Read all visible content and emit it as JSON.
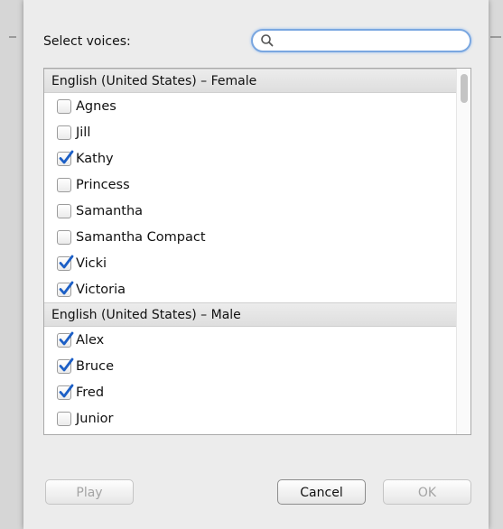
{
  "dialog": {
    "select_label": "Select voices:",
    "search": {
      "value": "",
      "placeholder": ""
    }
  },
  "voice_groups": [
    {
      "header": "English (United States) – Female",
      "voices": [
        {
          "name": "Agnes",
          "checked": false
        },
        {
          "name": "Jill",
          "checked": false
        },
        {
          "name": "Kathy",
          "checked": true
        },
        {
          "name": "Princess",
          "checked": false
        },
        {
          "name": "Samantha",
          "checked": false
        },
        {
          "name": "Samantha Compact",
          "checked": false
        },
        {
          "name": "Vicki",
          "checked": true
        },
        {
          "name": "Victoria",
          "checked": true
        }
      ]
    },
    {
      "header": "English (United States) – Male",
      "voices": [
        {
          "name": "Alex",
          "checked": true
        },
        {
          "name": "Bruce",
          "checked": true
        },
        {
          "name": "Fred",
          "checked": true
        },
        {
          "name": "Junior",
          "checked": false
        }
      ]
    }
  ],
  "buttons": {
    "play": "Play",
    "cancel": "Cancel",
    "ok": "OK"
  },
  "colors": {
    "checkmark": "#1c5fc6",
    "focus_ring": "#7aa7e0"
  }
}
